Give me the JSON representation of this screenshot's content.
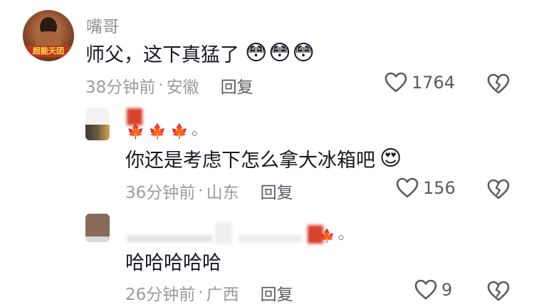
{
  "comments": [
    {
      "username": "嘴哥",
      "avatar_label": "超能天团",
      "text": "师父，这下真猛了",
      "emoji": "😳😳😳",
      "time": "38分钟前",
      "location": "安徽",
      "reply_label": "回复",
      "likes": "1764"
    },
    {
      "username_suffix": "。",
      "text": "你还是考虑下怎么拿大冰箱吧",
      "emoji": "😍",
      "time": "36分钟前",
      "location": "山东",
      "reply_label": "回复",
      "likes": "156"
    },
    {
      "username_suffix": "。",
      "text": "哈哈哈哈哈",
      "time": "26分钟前",
      "location": "广西",
      "reply_label": "回复",
      "likes": "9"
    }
  ],
  "separator": "·",
  "colors": {
    "text": "#161823",
    "meta": "#9a9ba1",
    "icon": "#5a5b61"
  }
}
